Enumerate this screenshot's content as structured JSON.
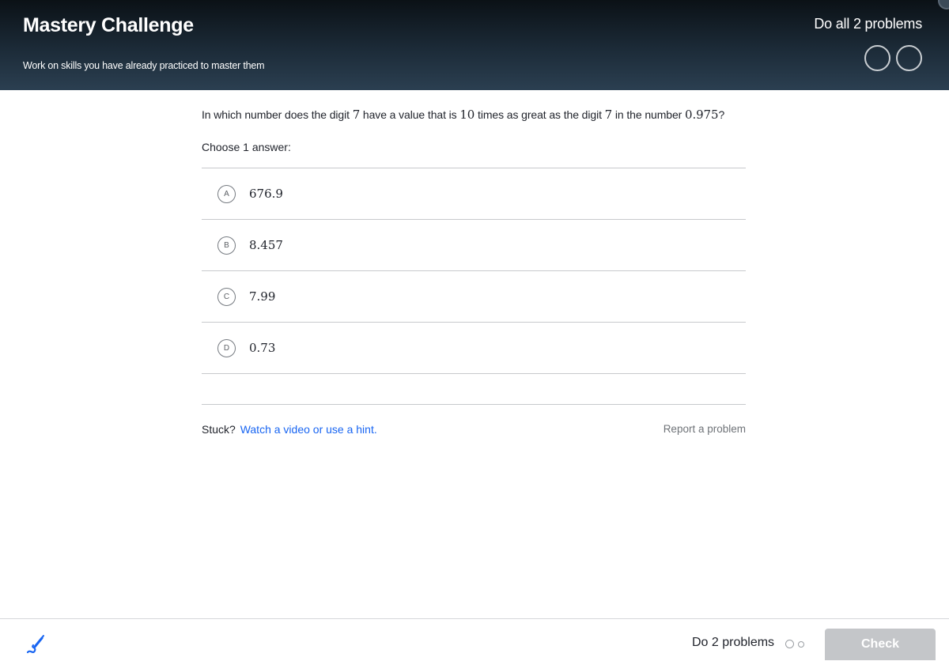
{
  "header": {
    "title": "Mastery Challenge",
    "subtitle": "Work on skills you have already practiced to master them",
    "goal": "Do all 2 problems",
    "problem_count": 2
  },
  "exercise": {
    "question": {
      "p1": "In which number does the digit ",
      "m1": "7",
      "p2": " have a value that is ",
      "m2": "10",
      "p3": " times as great as the digit ",
      "m3": "7",
      "p4": " in the number ",
      "m4": "0.975",
      "p5": "?"
    },
    "instruction": "Choose 1 answer:",
    "choices": [
      {
        "letter": "A",
        "value": "676.9"
      },
      {
        "letter": "B",
        "value": "8.457"
      },
      {
        "letter": "C",
        "value": "7.99"
      },
      {
        "letter": "D",
        "value": "0.73"
      }
    ],
    "stuck_label": "Stuck?",
    "hint_link": "Watch a video or use a hint.",
    "report_link": "Report a problem"
  },
  "footer": {
    "progress_label": "Do 2 problems",
    "check_label": "Check",
    "tool_icon": "scratchpad-pencil-icon",
    "colors": {
      "check_disabled": "#c4c6c9",
      "link": "#1865f2",
      "tool": "#1865f2"
    }
  }
}
